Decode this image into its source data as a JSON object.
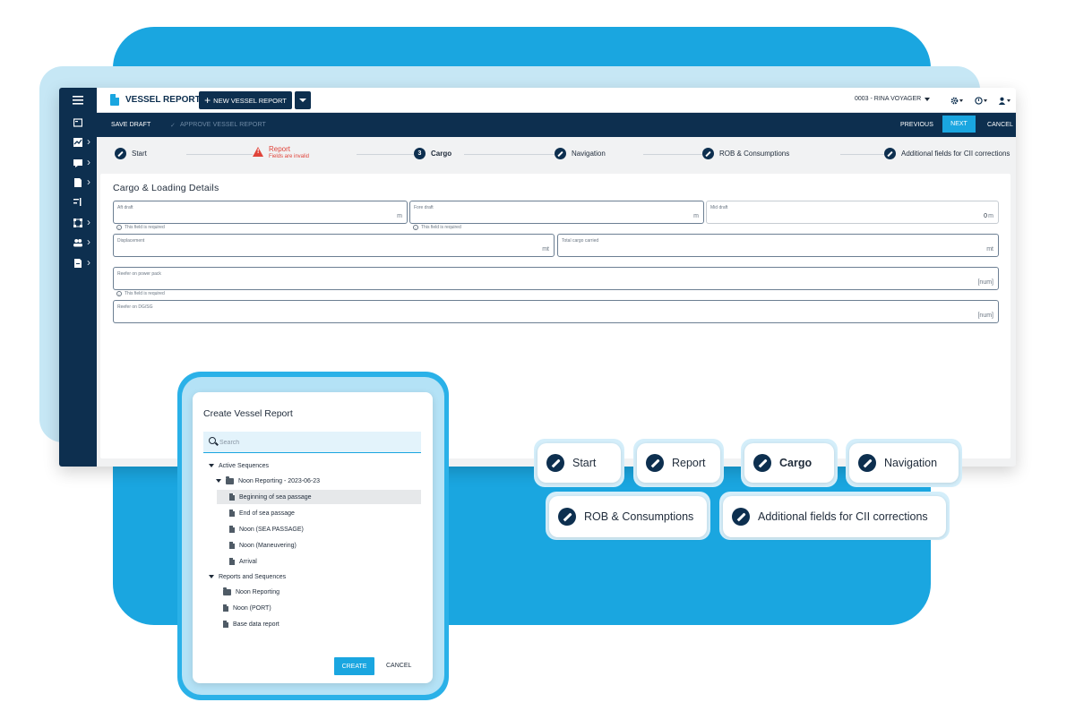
{
  "app": {
    "title": "VESSEL REPORT",
    "new_button": "NEW VESSEL REPORT",
    "vessel_selector": "0003 - RINA VOYAGER"
  },
  "actionbar": {
    "save_draft": "SAVE DRAFT",
    "approve": "APPROVE VESSEL REPORT",
    "previous": "PREVIOUS",
    "next": "NEXT",
    "cancel": "CANCEL"
  },
  "steps": {
    "start": "Start",
    "report": "Report",
    "report_error": "Fields are invalid",
    "cargo_number": "3",
    "cargo": "Cargo",
    "navigation": "Navigation",
    "rob": "ROB & Consumptions",
    "additional": "Additional fields for CII corrections"
  },
  "form": {
    "title": "Cargo & Loading Details",
    "required_hint": "This field is required",
    "aft_draft": {
      "label": "Aft draft",
      "unit": "m"
    },
    "fore_draft": {
      "label": "Fore draft",
      "unit": "m"
    },
    "mid_draft": {
      "label": "Mid draft",
      "value": "0",
      "unit": "m"
    },
    "displacement": {
      "label": "Displacement",
      "unit": "mt"
    },
    "total_cargo": {
      "label": "Total cargo carried",
      "unit": "mt"
    },
    "reefer_power": {
      "label": "Reefer on power pack",
      "unit": "[num]"
    },
    "reefer_dg": {
      "label": "Reefer on DG/SG",
      "unit": "[num]"
    }
  },
  "dialog": {
    "title": "Create Vessel Report",
    "search_placeholder": "Search",
    "tree": {
      "active_sequences": "Active Sequences",
      "noon_reporting_dated": "Noon Reporting - 2023-06-23",
      "beginning": "Beginning of sea passage",
      "end": "End of sea passage",
      "noon_sea": "Noon (SEA PASSAGE)",
      "noon_man": "Noon (Maneuvering)",
      "arrival": "Arrival",
      "reports_sequences": "Reports and Sequences",
      "noon_reporting": "Noon Reporting",
      "noon_port": "Noon (PORT)",
      "base_data": "Base data report"
    },
    "create": "CREATE",
    "cancel": "CANCEL"
  },
  "chips": {
    "start": "Start",
    "report": "Report",
    "cargo": "Cargo",
    "navigation": "Navigation",
    "rob": "ROB & Consumptions",
    "additional": "Additional fields for CII corrections"
  },
  "colors": {
    "navy": "#0d2f4f",
    "accent": "#1aa6e0",
    "error": "#e0443a"
  },
  "icons": [
    "hamburger-icon",
    "dashboard-icon",
    "chart-icon",
    "message-icon",
    "document-icon",
    "filter-icon",
    "workflow-icon",
    "users-icon",
    "file-icon",
    "gear-icon",
    "help-icon",
    "user-icon",
    "pencil-icon",
    "warning-icon",
    "search-icon",
    "folder-icon"
  ]
}
